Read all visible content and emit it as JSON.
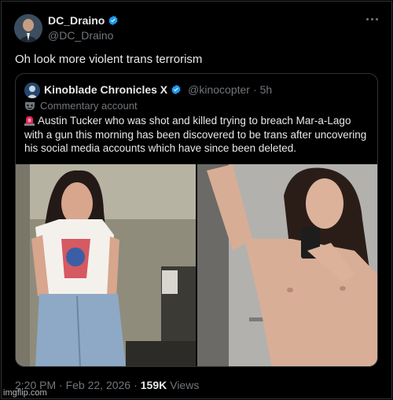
{
  "tweet": {
    "display_name": "DC_Draino",
    "handle": "@DC_Draino",
    "text": "Oh look more violent trans terrorism",
    "timestamp": "2:20 PM · Feb 22, 2026",
    "dot": "·",
    "views_count": "159K",
    "views_label": "Views"
  },
  "quote": {
    "display_name": "Kinoblade Chronicles X",
    "handle": "@kinocopter",
    "dot": "·",
    "time": "5h",
    "commentary_label": "Commentary account",
    "body": "Austin Tucker who was shot and killed trying to breach Mar-a-Lago with a gun this morning has been discovered to be trans after uncovering his social media accounts which have since been deleted."
  },
  "watermark": "imgflip.com",
  "colors": {
    "verified": "#1d9bf0",
    "text": "#e7e9ea",
    "muted": "#71767b",
    "border": "#2f3336",
    "siren": "#e0245e"
  },
  "icons": [
    "verified-badge-icon",
    "more-options-icon",
    "commentary-mask-icon",
    "siren-emoji-icon"
  ]
}
